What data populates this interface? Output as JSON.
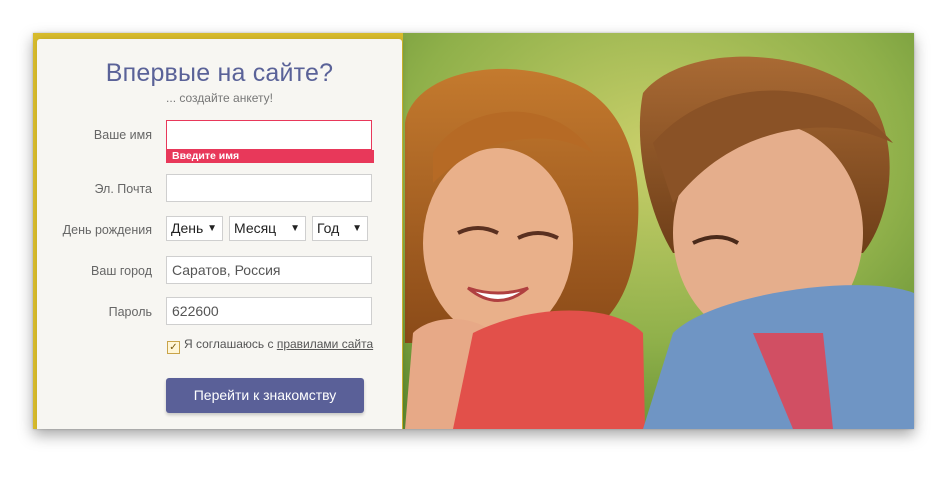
{
  "form": {
    "title": "Впервые на сайте?",
    "subtitle": "... создайте анкету!",
    "name_label": "Ваше имя",
    "name_value": "",
    "name_error": "Введите имя",
    "email_label": "Эл. Почта",
    "email_value": "",
    "birthday_label": "День рождения",
    "day_selected": "День",
    "month_selected": "Месяц",
    "year_selected": "Год",
    "city_label": "Ваш город",
    "city_value": "Саратов, Россия",
    "password_label": "Пароль",
    "password_value": "622600",
    "agree_prefix": "Я соглашаюсь с",
    "agree_link": "правилами сайта",
    "agree_checked": true,
    "submit_label": "Перейти к знакомству"
  },
  "colors": {
    "accent": "#5a6098",
    "error": "#e8385a",
    "title": "#5a6298"
  },
  "icons": {
    "checkbox": "check-icon",
    "dropdown": "triangle-down-icon"
  }
}
